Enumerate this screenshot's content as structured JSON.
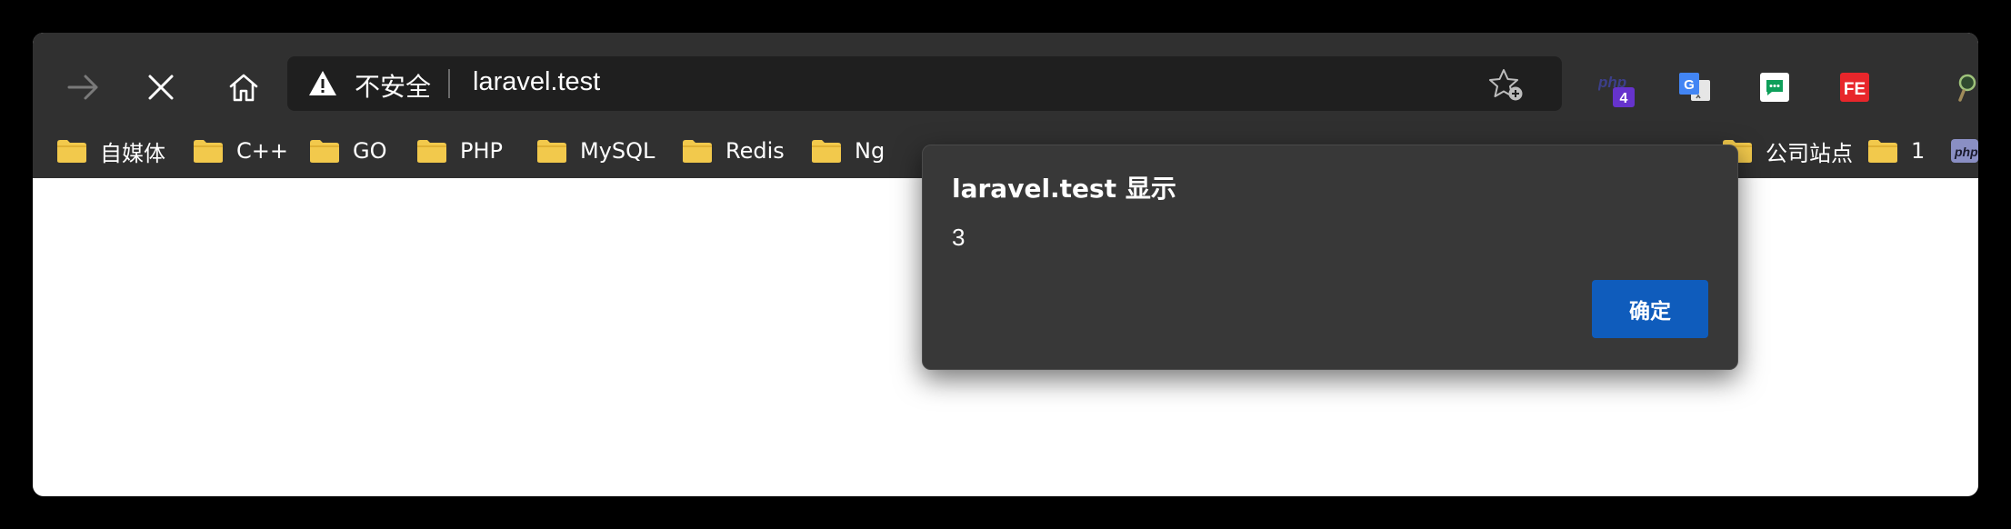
{
  "address_bar": {
    "security_label": "不安全",
    "url": "laravel.test"
  },
  "extensions": {
    "php_label": "php",
    "php_badge": "4",
    "google_translate_letter": "G",
    "fe_label": "FE"
  },
  "bookmarks": [
    {
      "label": "自媒体"
    },
    {
      "label": "C++"
    },
    {
      "label": "GO"
    },
    {
      "label": "PHP"
    },
    {
      "label": "MySQL"
    },
    {
      "label": "Redis"
    },
    {
      "label": "Ng"
    },
    {
      "label": "公司站点"
    },
    {
      "label": "1"
    }
  ],
  "dialog": {
    "title": "laravel.test 显示",
    "message": "3",
    "ok_label": "确定"
  },
  "colors": {
    "chrome": "#303030",
    "address_bg": "#1f1f1f",
    "dialog_bg": "#383838",
    "ok_button": "#0f5cbc",
    "folder": "#f2c94c",
    "php_badge": "#6633cc",
    "fe_red": "#e8262b"
  }
}
